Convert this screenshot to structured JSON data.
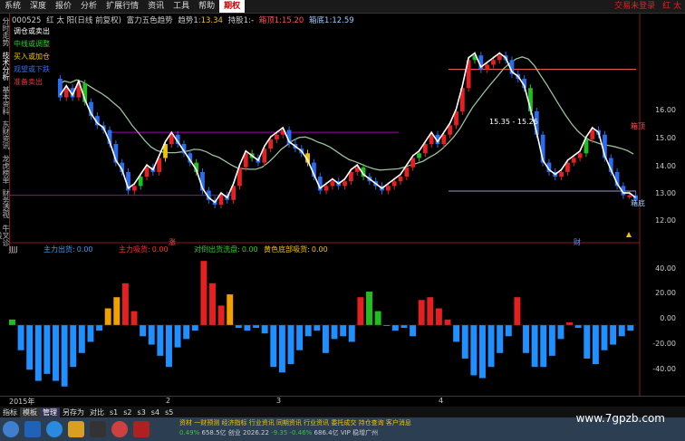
{
  "menu": {
    "items": [
      "系统",
      "深度",
      "报价",
      "分析",
      "扩展行情",
      "资讯",
      "工具",
      "帮助"
    ],
    "active": "期权",
    "right": [
      "交易未登录",
      "红 太"
    ]
  },
  "sidebar": {
    "tabs": [
      "分时走势",
      "技术分析",
      "基本资料",
      "东财资讯",
      "龙虎榜单",
      "财务透视",
      "牛叉诊股"
    ]
  },
  "title": {
    "code": "000525",
    "name": "红 太 阳(日线 前复权)",
    "indicator": "富力五色趋势",
    "trend_label": "趋势1:",
    "trend_value": "13.34",
    "hold_label": "持股1:",
    "hold_value": "-",
    "box_top_label": "箱顶1:",
    "box_top_value": "15.20",
    "box_bottom_label": "箱底1:",
    "box_bottom_value": "12.59"
  },
  "legend": [
    {
      "label": "调仓或卖出",
      "color": "#ffffff"
    },
    {
      "label": "中线或调整",
      "color": "#2ecc2e"
    },
    {
      "label": "买入或加仓",
      "color": "#f2c200"
    },
    {
      "label": "观望或下跌",
      "color": "#3a6df0"
    },
    {
      "label": "准备卖出",
      "color": "#ff2a2a"
    }
  ],
  "annotations": {
    "range": "15.35 - 15.26",
    "box_top": "箱顶",
    "box_bottom": "箱底",
    "rise_mark": "涨",
    "finance_mark": "财"
  },
  "sub_indicator": {
    "name": "JJJJ",
    "main_out_label": "主力出货:",
    "main_out_value": "0.00",
    "main_suck_label": "主力吸货:",
    "main_suck_value": "0.00",
    "counter_label": "对倒出货洗盘:",
    "counter_value": "0.00",
    "bottom_label": "黄色底部吸货:",
    "bottom_value": "0.00"
  },
  "axis": {
    "main_ticks": [
      "16.00",
      "15.00",
      "14.00",
      "13.00",
      "12.00"
    ],
    "sub_ticks": [
      "40.00",
      "20.00",
      "0.00",
      "-20.00",
      "-40.00"
    ]
  },
  "dates": {
    "year": "2015年",
    "m2": "2",
    "m3": "3",
    "m4": "4"
  },
  "bottom_tabs": [
    "指标",
    "模板",
    "管理",
    "另存为",
    "对比",
    "s1",
    "s2",
    "s3",
    "s4",
    "s5"
  ],
  "ticker": [
    "资材",
    "一财预测",
    "经济指标",
    "行业资讯",
    "同期资讯",
    "行业资讯",
    "委托成交",
    "持仓查询",
    "客户消息"
  ],
  "ticker2": [
    "0.49%",
    "658.5亿",
    "创业 2026.22",
    "-9.35",
    "-0.46%",
    "686.4亿",
    "VIP 稳增广州"
  ],
  "watermark": "www.7gpzb.com",
  "chart_data": {
    "type": "candlestick",
    "main_ylim": [
      11.6,
      16.3
    ],
    "sub_ylim": [
      -50,
      50
    ],
    "candles_open": [
      15.0,
      14.6,
      14.8,
      14.6,
      14.9,
      14.5,
      14.2,
      14.0,
      13.9,
      13.6,
      13.2,
      13.0,
      12.6,
      12.7,
      12.9,
      13.1,
      13.0,
      13.3,
      13.6,
      13.8,
      13.6,
      13.4,
      13.2,
      13.0,
      12.6,
      12.4,
      12.3,
      12.5,
      12.4,
      12.7,
      13.1,
      13.4,
      13.3,
      13.2,
      13.5,
      13.7,
      13.8,
      13.9,
      13.6,
      13.5,
      13.4,
      13.2,
      12.9,
      12.6,
      12.7,
      12.8,
      12.7,
      12.8,
      13.0,
      13.1,
      12.9,
      12.8,
      12.7,
      12.6,
      12.7,
      12.8,
      12.9,
      13.1,
      13.3,
      13.4,
      13.6,
      13.8,
      13.6,
      13.8,
      14.0,
      14.3,
      14.8,
      15.4,
      15.5,
      15.2,
      15.3,
      15.4,
      15.5,
      15.4,
      15.1,
      15.0,
      14.8,
      14.3,
      13.8,
      13.2,
      13.0,
      12.9,
      13.0,
      13.2,
      13.3,
      13.4,
      13.7,
      13.9,
      13.8,
      13.3,
      13.0,
      12.7,
      12.5,
      12.5
    ],
    "candles_close": [
      14.6,
      14.8,
      14.6,
      14.9,
      14.5,
      14.2,
      14.0,
      13.9,
      13.6,
      13.2,
      13.0,
      12.6,
      12.7,
      12.9,
      13.1,
      13.0,
      13.3,
      13.6,
      13.8,
      13.6,
      13.4,
      13.2,
      13.0,
      12.6,
      12.4,
      12.3,
      12.5,
      12.4,
      12.7,
      13.1,
      13.4,
      13.3,
      13.2,
      13.5,
      13.7,
      13.8,
      13.9,
      13.6,
      13.5,
      13.4,
      13.2,
      12.9,
      12.6,
      12.7,
      12.8,
      12.7,
      12.8,
      13.0,
      13.1,
      12.9,
      12.8,
      12.7,
      12.6,
      12.7,
      12.8,
      12.9,
      13.1,
      13.3,
      13.4,
      13.6,
      13.8,
      13.6,
      13.8,
      14.0,
      14.3,
      14.8,
      15.4,
      15.5,
      15.2,
      15.3,
      15.4,
      15.5,
      15.4,
      15.1,
      15.0,
      14.8,
      14.3,
      13.8,
      13.2,
      13.0,
      12.9,
      13.0,
      13.2,
      13.3,
      13.4,
      13.7,
      13.9,
      13.8,
      13.3,
      13.0,
      12.7,
      12.5,
      12.5,
      12.4
    ],
    "sub_values": [
      4,
      -18,
      -32,
      -40,
      -35,
      -40,
      -44,
      -30,
      -20,
      -12,
      -4,
      12,
      20,
      30,
      10,
      -8,
      -14,
      -22,
      -30,
      -16,
      -10,
      -4,
      46,
      30,
      14,
      22,
      -2,
      -4,
      -2,
      -6,
      -30,
      -34,
      -28,
      -18,
      -8,
      -4,
      -20,
      -10,
      -8,
      -12,
      20,
      24,
      10,
      0,
      -4,
      -2,
      -8,
      18,
      20,
      12,
      4,
      -12,
      -24,
      -36,
      -38,
      -30,
      -20,
      -8,
      20,
      -20,
      -30,
      -30,
      -22,
      -10,
      2,
      -2,
      -24,
      -28,
      -18,
      -14,
      -8,
      -4
    ],
    "sub_colors": [
      "g",
      "b",
      "b",
      "b",
      "b",
      "b",
      "b",
      "b",
      "b",
      "b",
      "b",
      "r",
      "r",
      "r",
      "r",
      "b",
      "b",
      "b",
      "b",
      "b",
      "b",
      "b",
      "r",
      "r",
      "r",
      "g",
      "b",
      "b",
      "b",
      "b",
      "b",
      "b",
      "b",
      "b",
      "b",
      "b",
      "b",
      "b",
      "b",
      "b",
      "r",
      "g",
      "g",
      "b",
      "b",
      "b",
      "b",
      "r",
      "r",
      "r",
      "r",
      "b",
      "b",
      "b",
      "b",
      "b",
      "b",
      "b",
      "r",
      "b",
      "b",
      "b",
      "b",
      "b",
      "r",
      "b",
      "b",
      "b",
      "b",
      "b",
      "b",
      "b"
    ]
  }
}
